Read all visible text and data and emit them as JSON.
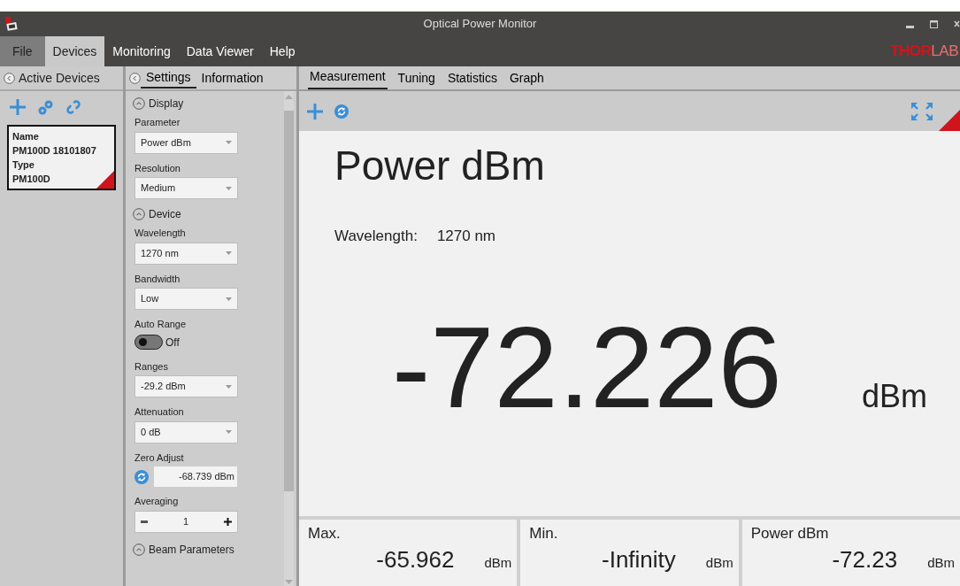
{
  "window": {
    "title": "Optical Power Monitor"
  },
  "menu": [
    {
      "label": "File",
      "kind": "file",
      "selected": false
    },
    {
      "label": "Devices",
      "kind": "tab",
      "selected": true
    },
    {
      "label": "Monitoring",
      "kind": "tab",
      "selected": false
    },
    {
      "label": "Data Viewer",
      "kind": "tab",
      "selected": false
    },
    {
      "label": "Help",
      "kind": "tab",
      "selected": false
    }
  ],
  "logo": {
    "bold": "THOR",
    "light": "LAB"
  },
  "devices_panel": {
    "title": "Active Devices",
    "devices": [
      {
        "selected": true,
        "fields": [
          {
            "label": "Name",
            "value": "PM100D 18101807"
          },
          {
            "label": "Type",
            "value": "PM100D"
          }
        ]
      }
    ]
  },
  "settings_panel": {
    "tabs": [
      {
        "label": "Settings",
        "selected": true
      },
      {
        "label": "Information",
        "selected": false
      }
    ],
    "sections": [
      {
        "title": "Display",
        "expanded": true,
        "fields": [
          {
            "kind": "dropdown",
            "label": "Parameter",
            "value": "Power dBm"
          },
          {
            "kind": "dropdown",
            "label": "Resolution",
            "value": "Medium"
          }
        ]
      },
      {
        "title": "Device",
        "expanded": true,
        "fields": [
          {
            "kind": "dropdown",
            "label": "Wavelength",
            "value": "1270 nm"
          },
          {
            "kind": "dropdown",
            "label": "Bandwidth",
            "value": "Low"
          },
          {
            "kind": "toggle",
            "label": "Auto Range",
            "on": false,
            "value": "Off"
          },
          {
            "kind": "dropdown",
            "label": "Ranges",
            "value": "-29.2 dBm"
          },
          {
            "kind": "dropdown",
            "label": "Attenuation",
            "value": "0 dB"
          },
          {
            "kind": "zero",
            "label": "Zero Adjust",
            "value": "-68.739 dBm"
          },
          {
            "kind": "stepper",
            "label": "Averaging",
            "value": "1"
          }
        ]
      },
      {
        "title": "Beam Parameters",
        "expanded": true
      }
    ]
  },
  "main": {
    "tabs": [
      {
        "label": "Measurement",
        "selected": true
      },
      {
        "label": "Tuning",
        "selected": false
      },
      {
        "label": "Statistics",
        "selected": false
      },
      {
        "label": "Graph",
        "selected": false
      }
    ],
    "heading": "Power dBm",
    "wavelength_label": "Wavelength:",
    "wavelength_value": "1270 nm",
    "reading": "-72.226",
    "unit": "dBm",
    "stats": [
      {
        "title": "Max.",
        "value": "-65.962",
        "unit": "dBm"
      },
      {
        "title": "Min.",
        "value": "-Infinity",
        "unit": "dBm"
      },
      {
        "title": "Power dBm",
        "value": "-72.23",
        "unit": "dBm"
      }
    ]
  }
}
